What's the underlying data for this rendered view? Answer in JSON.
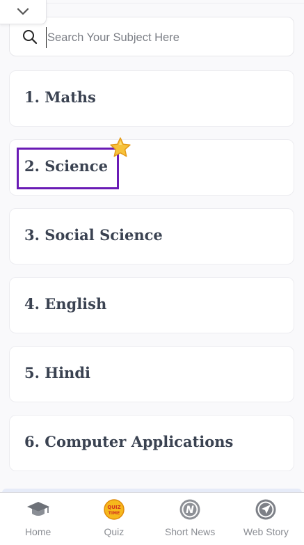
{
  "search": {
    "placeholder": "Search Your Subject Here"
  },
  "subjects": [
    {
      "label": "1. Maths"
    },
    {
      "label": "2. Science"
    },
    {
      "label": "3. Social Science"
    },
    {
      "label": "4. English"
    },
    {
      "label": "5. Hindi"
    },
    {
      "label": "6. Computer Applications"
    }
  ],
  "highlight": {
    "target": "2. Science",
    "color": "#6a1bb5"
  },
  "bottom_nav": {
    "items": [
      {
        "label": "Home",
        "icon": "graduation-cap-icon"
      },
      {
        "label": "Quiz",
        "icon": "quiz-time-icon",
        "icon_text": "QUIZ TIME"
      },
      {
        "label": "Short News",
        "icon": "news-n-icon",
        "icon_text": "N"
      },
      {
        "label": "Web Story",
        "icon": "paper-plane-icon"
      }
    ]
  },
  "colors": {
    "text": "#3a4251",
    "highlight": "#6a1bb5",
    "nav_label": "#8a8d93"
  }
}
